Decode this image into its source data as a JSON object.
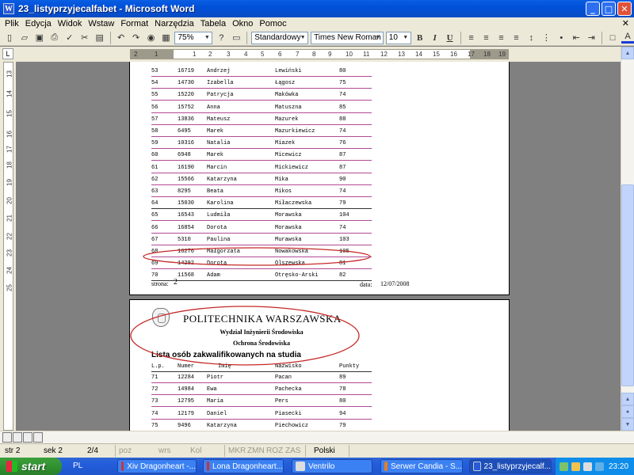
{
  "window": {
    "title": "23_listyprzyjecalfabet - Microsoft Word",
    "app_icon_letter": "W",
    "buttons": {
      "minimize": "_",
      "maximize": "□",
      "close": "✕"
    }
  },
  "menu": [
    "Plik",
    "Edycja",
    "Widok",
    "Wstaw",
    "Format",
    "Narzędzia",
    "Tabela",
    "Okno",
    "Pomoc"
  ],
  "menu_close": "✕",
  "toolbar": {
    "zoom": "75%",
    "style": "Standardowy",
    "font": "Times New Roman",
    "size": "10",
    "bold": "B",
    "italic": "I",
    "underline": "U",
    "font_color_letter": "A"
  },
  "ruler": {
    "corner": "L",
    "h_labels": [
      "2",
      "1",
      "1",
      "2",
      "3",
      "4",
      "5",
      "6",
      "7",
      "8",
      "9",
      "10",
      "11",
      "12",
      "13",
      "14",
      "15",
      "16",
      "17",
      "18",
      "19"
    ],
    "v_labels": [
      "13",
      "14",
      "15",
      "16",
      "17",
      "18",
      "19",
      "20",
      "21",
      "22",
      "23",
      "24",
      "25"
    ]
  },
  "page1": {
    "rows": [
      {
        "lp": "53",
        "num": "16719",
        "imie": "Andrzej",
        "nazwisko": "Lewiński",
        "pkt": "80"
      },
      {
        "lp": "54",
        "num": "14730",
        "imie": "Izabella",
        "nazwisko": "Łągosz",
        "pkt": "75"
      },
      {
        "lp": "55",
        "num": "15220",
        "imie": "Patrycja",
        "nazwisko": "Makówka",
        "pkt": "74"
      },
      {
        "lp": "56",
        "num": "15752",
        "imie": "Anna",
        "nazwisko": "Matuszna",
        "pkt": "85"
      },
      {
        "lp": "57",
        "num": "13836",
        "imie": "Mateusz",
        "nazwisko": "Mazurek",
        "pkt": "88"
      },
      {
        "lp": "58",
        "num": "6495",
        "imie": "Marek",
        "nazwisko": "Mazurkiewicz",
        "pkt": "74"
      },
      {
        "lp": "59",
        "num": "10316",
        "imie": "Natalia",
        "nazwisko": "Miazek",
        "pkt": "76"
      },
      {
        "lp": "60",
        "num": "6948",
        "imie": "Marek",
        "nazwisko": "Micewicz",
        "pkt": "87"
      },
      {
        "lp": "61",
        "num": "16190",
        "imie": "Marcin",
        "nazwisko": "Mickiewicz",
        "pkt": "87"
      },
      {
        "lp": "62",
        "num": "15566",
        "imie": "Katarzyna",
        "nazwisko": "Mika",
        "pkt": "90"
      },
      {
        "lp": "63",
        "num": "8295",
        "imie": "Beata",
        "nazwisko": "Mikos",
        "pkt": "74"
      },
      {
        "lp": "64",
        "num": "15030",
        "imie": "Karolina",
        "nazwisko": "Miłaczewska",
        "pkt": "79"
      },
      {
        "lp": "65",
        "num": "16543",
        "imie": "Ludmiła",
        "nazwisko": "Morawska",
        "pkt": "104"
      },
      {
        "lp": "66",
        "num": "16854",
        "imie": "Dorota",
        "nazwisko": "Morawska",
        "pkt": "74"
      },
      {
        "lp": "67",
        "num": "5310",
        "imie": "Paulina",
        "nazwisko": "Murawska",
        "pkt": "103"
      },
      {
        "lp": "68",
        "num": "16276",
        "imie": "Małgorzata",
        "nazwisko": "Nowakowska",
        "pkt": "105"
      },
      {
        "lp": "69",
        "num": "14292",
        "imie": "Dorota",
        "nazwisko": "Olszewska",
        "pkt": "81"
      },
      {
        "lp": "70",
        "num": "11568",
        "imie": "Adam",
        "nazwisko": "Otręsko-Arski",
        "pkt": "82"
      }
    ],
    "footer": {
      "page_label": "strona:",
      "page_num": "2",
      "date_label": "data:",
      "date": "12/07/2008"
    }
  },
  "page2": {
    "university": "POLITECHNIKA WARSZAWSKA",
    "faculty": "Wydział Inżynierii Środowiska",
    "program": "Ochrona Środowiska",
    "list_title": "Lista osób zakwalifikowanych na studia",
    "headers": {
      "lp": "L.p.",
      "num": "Numer",
      "imie": "Imię",
      "nazwisko": "Nazwisko",
      "pkt": "Punkty"
    },
    "rows": [
      {
        "lp": "71",
        "num": "12284",
        "imie": "Piotr",
        "nazwisko": "Pacan",
        "pkt": "89"
      },
      {
        "lp": "72",
        "num": "14984",
        "imie": "Ewa",
        "nazwisko": "Pachecka",
        "pkt": "78"
      },
      {
        "lp": "73",
        "num": "12795",
        "imie": "Maria",
        "nazwisko": "Pers",
        "pkt": "80"
      },
      {
        "lp": "74",
        "num": "12179",
        "imie": "Daniel",
        "nazwisko": "Piasecki",
        "pkt": "94"
      },
      {
        "lp": "75",
        "num": "9496",
        "imie": "Katarzyna",
        "nazwisko": "Piechowicz",
        "pkt": "79"
      }
    ]
  },
  "status": {
    "page": "str 2",
    "section": "sek 2",
    "pages": "2/4",
    "pos": "poz",
    "line": "wrs",
    "col": "Kol",
    "rec": "MKR",
    "trk": "ZMN",
    "ext": "ROZ",
    "ovr": "ZAS",
    "lang": "Polski"
  },
  "taskbar": {
    "start": "start",
    "lang": "PL",
    "tasks": [
      "Xiv Dragonheart -...",
      "Lona Dragonheart...",
      "Ventrilo",
      "Serwer Candia - S...",
      "23_listyprzyjecalf..."
    ],
    "clock": "23:20"
  },
  "colors": {
    "row_line": "#b24a95",
    "annotation_ellipse": "#c62828",
    "titlebar": "#0a5fe4",
    "taskbar": "#245edb"
  }
}
